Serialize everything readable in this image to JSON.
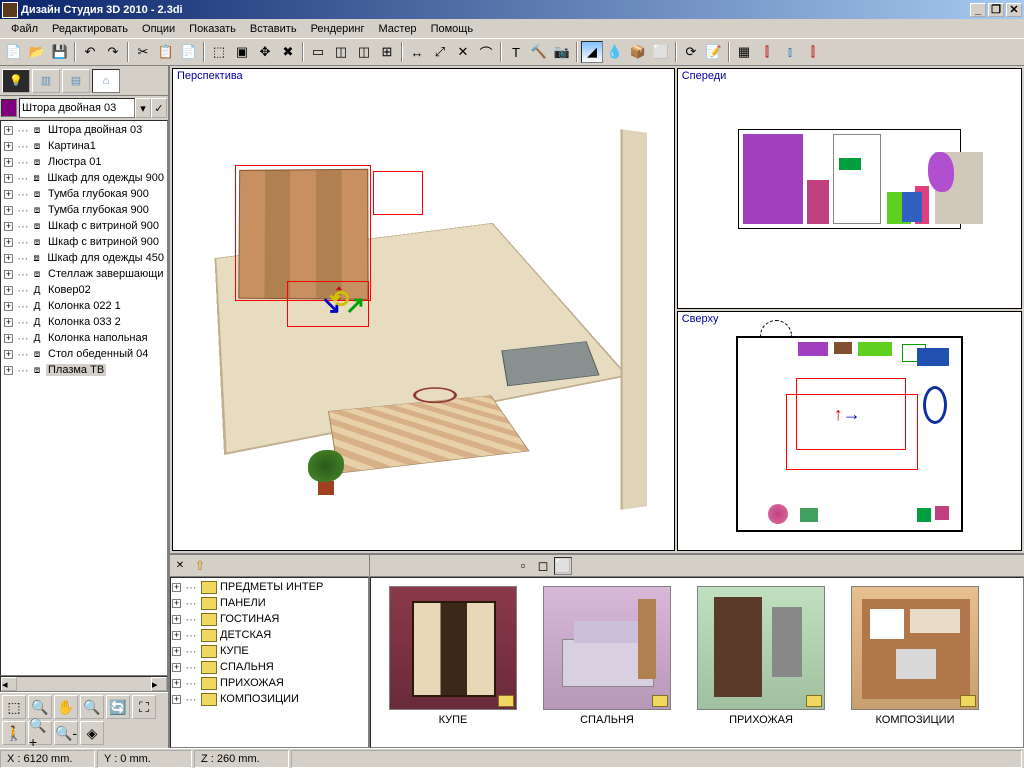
{
  "title": "Дизайн Студия 3D 2010 - 2.3di",
  "menu": [
    "Файл",
    "Редактировать",
    "Опции",
    "Показать",
    "Вставить",
    "Рендеринг",
    "Мастер",
    "Помощь"
  ],
  "combo_value": "Штора двойная 03",
  "tree": [
    "Штора двойная 03",
    "Картина1",
    "Люстра 01",
    "Шкаф для одежды 900",
    "Тумба глубокая 900",
    "Тумба глубокая 900",
    "Шкаф с витриной 900",
    "Шкаф с витриной 900",
    "Шкаф для одежды 450",
    "Стеллаж завершающи",
    "Ковер02",
    "Колонка 022 1",
    "Колонка 033 2",
    "Колонка напольная",
    "Стол обеденный 04",
    "Плазма ТВ"
  ],
  "tree_d_icons": [
    10,
    11,
    12,
    13
  ],
  "tree_selected": 15,
  "views": {
    "perspective": "Перспектива",
    "front": "Спереди",
    "top": "Сверху"
  },
  "gallery_tree": [
    "ПРЕДМЕТЫ ИНТЕР",
    "ПАНЕЛИ",
    "ГОСТИНАЯ",
    "ДЕТСКАЯ",
    "КУПЕ",
    "СПАЛЬНЯ",
    "ПРИХОЖАЯ",
    "КОМПОЗИЦИИ"
  ],
  "thumbs": [
    "КУПЕ",
    "СПАЛЬНЯ",
    "ПРИХОЖАЯ",
    "КОМПОЗИЦИИ"
  ],
  "status": {
    "x": "X : 6120 mm.",
    "y": "Y : 0 mm.",
    "z": "Z : 260 mm."
  }
}
